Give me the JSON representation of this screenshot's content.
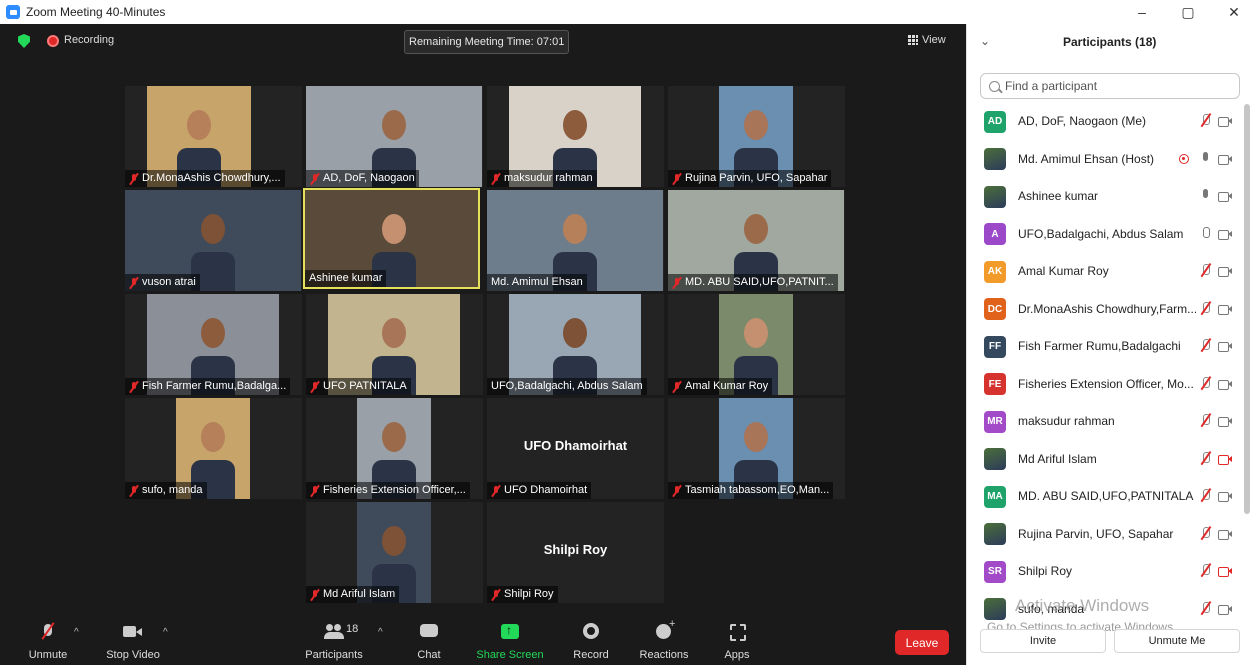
{
  "window": {
    "title": "Zoom Meeting 40-Minutes",
    "min": "–",
    "max": "▢",
    "close": "✕"
  },
  "topbar": {
    "recording": "Recording",
    "remaining": "Remaining Meeting Time: 07:01",
    "view": "View"
  },
  "tiles": [
    {
      "name": "Dr.MonaAshis Chowdhury,...",
      "muted": true
    },
    {
      "name": "AD, DoF, Naogaon",
      "muted": true
    },
    {
      "name": "maksudur rahman",
      "muted": true
    },
    {
      "name": "Rujina Parvin, UFO, Sapahar",
      "muted": true
    },
    {
      "name": "vuson atrai",
      "muted": true
    },
    {
      "name": "Ashinee kumar",
      "muted": false
    },
    {
      "name": "Md. Amimul Ehsan",
      "muted": false
    },
    {
      "name": "MD. ABU SAID,UFO,PATNIT...",
      "muted": true
    },
    {
      "name": "Fish Farmer Rumu,Badalga...",
      "muted": true
    },
    {
      "name": "UFO PATNITALA",
      "muted": true
    },
    {
      "name": "UFO,Badalgachi, Abdus Salam",
      "muted": false
    },
    {
      "name": "Amal Kumar Roy",
      "muted": true
    },
    {
      "name": "sufo, manda",
      "muted": true
    },
    {
      "name": "Fisheries Extension Officer,...",
      "muted": true
    },
    {
      "name": "UFO Dhamoirhat",
      "muted": true,
      "center": "UFO Dhamoirhat"
    },
    {
      "name": "Tasmiah tabassom,EO,Man...",
      "muted": true
    },
    {
      "name": "Md Ariful Islam",
      "muted": true
    },
    {
      "name": "Shilpi Roy",
      "muted": true,
      "center": "Shilpi Roy"
    }
  ],
  "toolbar": {
    "unmute": "Unmute",
    "stop_video": "Stop Video",
    "participants": "Participants",
    "participants_count": "18",
    "chat": "Chat",
    "share": "Share Screen",
    "record": "Record",
    "reactions": "Reactions",
    "apps": "Apps",
    "leave": "Leave"
  },
  "panel": {
    "title": "Participants (18)",
    "search_placeholder": "Find a participant",
    "participants": [
      {
        "initials": "AD",
        "color": "#1fa36a",
        "name": "AD, DoF, Naogaon (Me)",
        "mic": "off",
        "cam": "on"
      },
      {
        "initials": "",
        "color": "",
        "name": "Md. Amimul Ehsan (Host)",
        "mic": "on",
        "cam": "on",
        "rec": true
      },
      {
        "initials": "",
        "color": "",
        "name": "Ashinee kumar",
        "mic": "on",
        "cam": "on"
      },
      {
        "initials": "A",
        "color": "#9b49c9",
        "name": "UFO,Badalgachi, Abdus Salam",
        "mic": "hollow",
        "cam": "on"
      },
      {
        "initials": "AK",
        "color": "#f29b2b",
        "name": "Amal Kumar Roy",
        "mic": "off",
        "cam": "on"
      },
      {
        "initials": "DC",
        "color": "#e0621b",
        "name": "Dr.MonaAshis Chowdhury,Farm...",
        "mic": "off",
        "cam": "on"
      },
      {
        "initials": "FF",
        "color": "#34495e",
        "name": "Fish Farmer Rumu,Badalgachi",
        "mic": "off",
        "cam": "on"
      },
      {
        "initials": "FE",
        "color": "#d6322e",
        "name": "Fisheries Extension Officer, Mo...",
        "mic": "off",
        "cam": "on"
      },
      {
        "initials": "MR",
        "color": "#a24ac8",
        "name": "maksudur rahman",
        "mic": "off",
        "cam": "on"
      },
      {
        "initials": "",
        "color": "",
        "name": "Md Ariful Islam",
        "mic": "off",
        "cam": "off"
      },
      {
        "initials": "MA",
        "color": "#1fa36a",
        "name": "MD. ABU SAID,UFO,PATNITALA",
        "mic": "off",
        "cam": "on"
      },
      {
        "initials": "",
        "color": "",
        "name": "Rujina Parvin, UFO, Sapahar",
        "mic": "off",
        "cam": "on"
      },
      {
        "initials": "SR",
        "color": "#a24ac8",
        "name": "Shilpi Roy",
        "mic": "off",
        "cam": "off"
      },
      {
        "initials": "",
        "color": "",
        "name": "sufo, manda",
        "mic": "off",
        "cam": "on"
      }
    ],
    "watermark_title": "Activate Windows",
    "watermark_sub": "Go to Settings to activate Windows.",
    "invite": "Invite",
    "unmute_me": "Unmute Me"
  }
}
